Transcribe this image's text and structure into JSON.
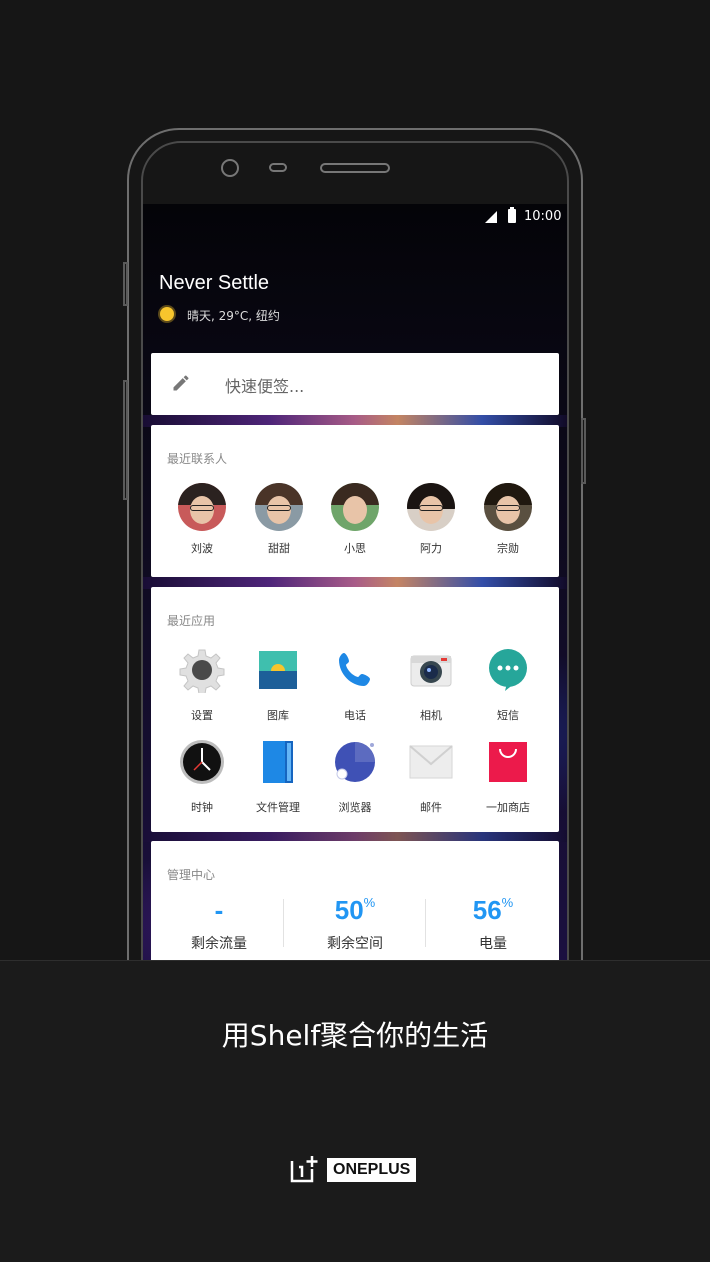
{
  "status_bar": {
    "time": "10:00"
  },
  "header": {
    "title": "Never Settle",
    "weather": "晴天, 29°C, 纽约"
  },
  "note_card": {
    "placeholder": "快速便签..."
  },
  "contacts_card": {
    "title": "最近联系人",
    "contacts": [
      {
        "name": "刘波"
      },
      {
        "name": "甜甜"
      },
      {
        "name": "小思"
      },
      {
        "name": "阿力"
      },
      {
        "name": "宗勋"
      }
    ]
  },
  "apps_card": {
    "title": "最近应用",
    "apps": [
      {
        "label": "设置",
        "icon": "settings-icon"
      },
      {
        "label": "图库",
        "icon": "gallery-icon"
      },
      {
        "label": "电话",
        "icon": "phone-icon"
      },
      {
        "label": "相机",
        "icon": "camera-icon"
      },
      {
        "label": "短信",
        "icon": "messages-icon"
      },
      {
        "label": "时钟",
        "icon": "clock-icon"
      },
      {
        "label": "文件管理",
        "icon": "file-manager-icon"
      },
      {
        "label": "浏览器",
        "icon": "browser-icon"
      },
      {
        "label": "邮件",
        "icon": "mail-icon"
      },
      {
        "label": "一加商店",
        "icon": "store-icon"
      }
    ]
  },
  "management_card": {
    "title": "管理中心",
    "stats": [
      {
        "value": "-",
        "unit": "",
        "label": "剩余流量"
      },
      {
        "value": "50",
        "unit": "%",
        "label": "剩余空间"
      },
      {
        "value": "56",
        "unit": "%",
        "label": "电量"
      }
    ]
  },
  "footer": {
    "tagline": "用Shelf聚合你的生活",
    "brand": "ONEPLUS"
  },
  "colors": {
    "accent": "#2196f3",
    "background": "#161616",
    "card": "#ffffff",
    "store_red": "#ec1a4b"
  }
}
